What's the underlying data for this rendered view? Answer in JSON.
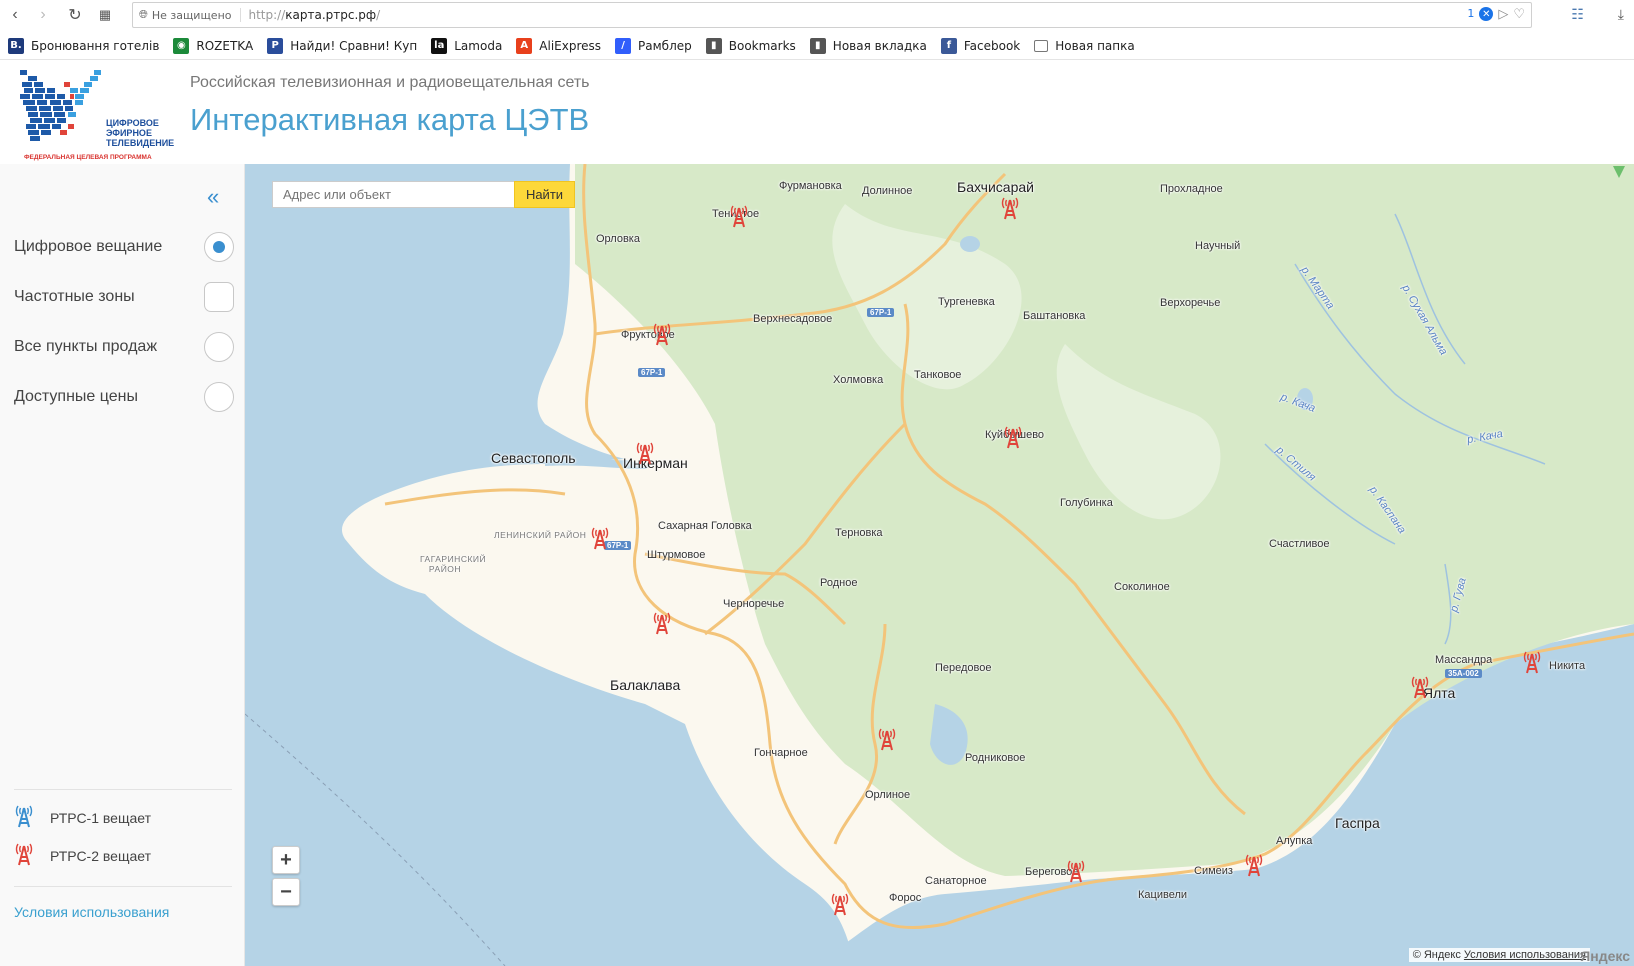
{
  "browser": {
    "security_label": "Не защищено",
    "url_prefix": "http://",
    "url_host": "карта.ртрс.рф",
    "url_suffix": "/",
    "badge_count": "1"
  },
  "bookmarks": [
    {
      "label": "Бронювання готелів",
      "icon": "booking-icon",
      "color": "#1e3a7b",
      "glyph": "B."
    },
    {
      "label": "ROZETKA",
      "icon": "rozetka-icon",
      "color": "#1c8a3a",
      "glyph": "◉"
    },
    {
      "label": "Найди! Сравни! Куп",
      "icon": "price-icon",
      "color": "#2a4d9b",
      "glyph": "P"
    },
    {
      "label": "Lamoda",
      "icon": "lamoda-icon",
      "color": "#111111",
      "glyph": "la"
    },
    {
      "label": "AliExpress",
      "icon": "aliexpress-icon",
      "color": "#e8401c",
      "glyph": "A"
    },
    {
      "label": "Рамблер",
      "icon": "rambler-icon",
      "color": "#315efb",
      "glyph": "/"
    },
    {
      "label": "Bookmarks",
      "icon": "page-icon",
      "color": "#555555",
      "glyph": "▮"
    },
    {
      "label": "Новая вкладка",
      "icon": "page-icon",
      "color": "#555555",
      "glyph": "▮"
    },
    {
      "label": "Facebook",
      "icon": "facebook-icon",
      "color": "#3b5998",
      "glyph": "f"
    },
    {
      "label": "Новая папка",
      "icon": "folder-icon",
      "color": "#ffffff",
      "glyph": "□"
    }
  ],
  "header": {
    "logo_line1": "ЦИФРОВОЕ",
    "logo_line2": "ЭФИРНОЕ",
    "logo_line3": "ТЕЛЕВИДЕНИЕ",
    "logo_program": "ФЕДЕРАЛЬНАЯ ЦЕЛЕВАЯ ПРОГРАММА",
    "subtitle": "Российская телевизионная и радиовещательная сеть",
    "title": "Интерактивная карта ЦЭТВ"
  },
  "sidebar": {
    "collapse_glyph": "«",
    "menu": [
      {
        "label": "Цифровое вещание",
        "control": "radio",
        "selected": true
      },
      {
        "label": "Частотные зоны",
        "control": "square",
        "selected": false
      },
      {
        "label": "Все пункты продаж",
        "control": "radio",
        "selected": false
      },
      {
        "label": "Доступные цены",
        "control": "radio",
        "selected": false
      }
    ],
    "legend": [
      {
        "label": "РТРС-1 вещает",
        "color": "#3a8fcf"
      },
      {
        "label": "РТРС-2 вещает",
        "color": "#e0443a"
      }
    ],
    "terms": "Условия использования"
  },
  "map": {
    "search_placeholder": "Адрес или объект",
    "search_button": "Найти",
    "zoom_in": "+",
    "zoom_out": "−",
    "copyright_prefix": "© Яндекс",
    "copyright_link": "Условия использования",
    "yandex_logo": "Яндекс",
    "colors": {
      "sea": "#b5d3e6",
      "land": "#fbf8ef",
      "forest": "#d7e9c8",
      "road": "#f3c47a",
      "tower": "#e0443a"
    },
    "labels": {
      "furmanovka": "Фурмановка",
      "dolinnoe": "Долинное",
      "bakhchisaray": "Бахчисарай",
      "prokhladnoe": "Прохладное",
      "tenistoe": "Тенистое",
      "orlovka": "Орловка",
      "nauchny": "Научный",
      "turgenevka": "Тургеневка",
      "bashtanovka": "Баштановка",
      "verkhorechye": "Верхоречье",
      "verkhnesadovoe": "Верхнесадовое",
      "fruktovoe": "Фруктовое",
      "kholmovka": "Холмовка",
      "tankovoe": "Танковое",
      "kuybyshevo": "Куйбышево",
      "sevastopol": "Севастополь",
      "inkerman": "Инкерман",
      "golubinka": "Голубинка",
      "leninsky": "ЛЕНИНСКИЙ РАЙОН",
      "sakharnaya": "Сахарная Головка",
      "ternovka": "Терновка",
      "gagarinsky": "ГАГАРИНСКИЙ РАЙОН",
      "shturmovoe": "Штурмовое",
      "schastlivoe": "Счастливое",
      "rodnoe": "Родное",
      "sokolinoe": "Соколиное",
      "chernorechye": "Черноречье",
      "balaklava": "Балаклава",
      "peredovoe": "Передовое",
      "massandra": "Массандра",
      "nikita": "Никита",
      "yalta": "Ялта",
      "goncharnoe": "Гончарное",
      "rodnikovoe": "Родниковое",
      "orlinoe": "Орлиное",
      "gaspra": "Гаспра",
      "alupka": "Алупка",
      "beregovoe": "Береговое",
      "simeiz": "Симеиз",
      "sanatornoe": "Санаторное",
      "foros": "Форос",
      "katsiveli": "Кацивели",
      "r_marta": "р. Марта",
      "r_sukhaya_alma": "р. Сухая Альма",
      "r_kacha": "р. Кача",
      "r_kacha2": "р. Кача",
      "r_stilya": "р. Стиля",
      "r_kaspana": "р. Каспана",
      "r_guva": "р. Гува",
      "road_67p1_a": "67Р-1",
      "road_67p1_b": "67Р-1",
      "road_67p1_c": "67Р-1",
      "road_35a002": "35А-002"
    }
  }
}
